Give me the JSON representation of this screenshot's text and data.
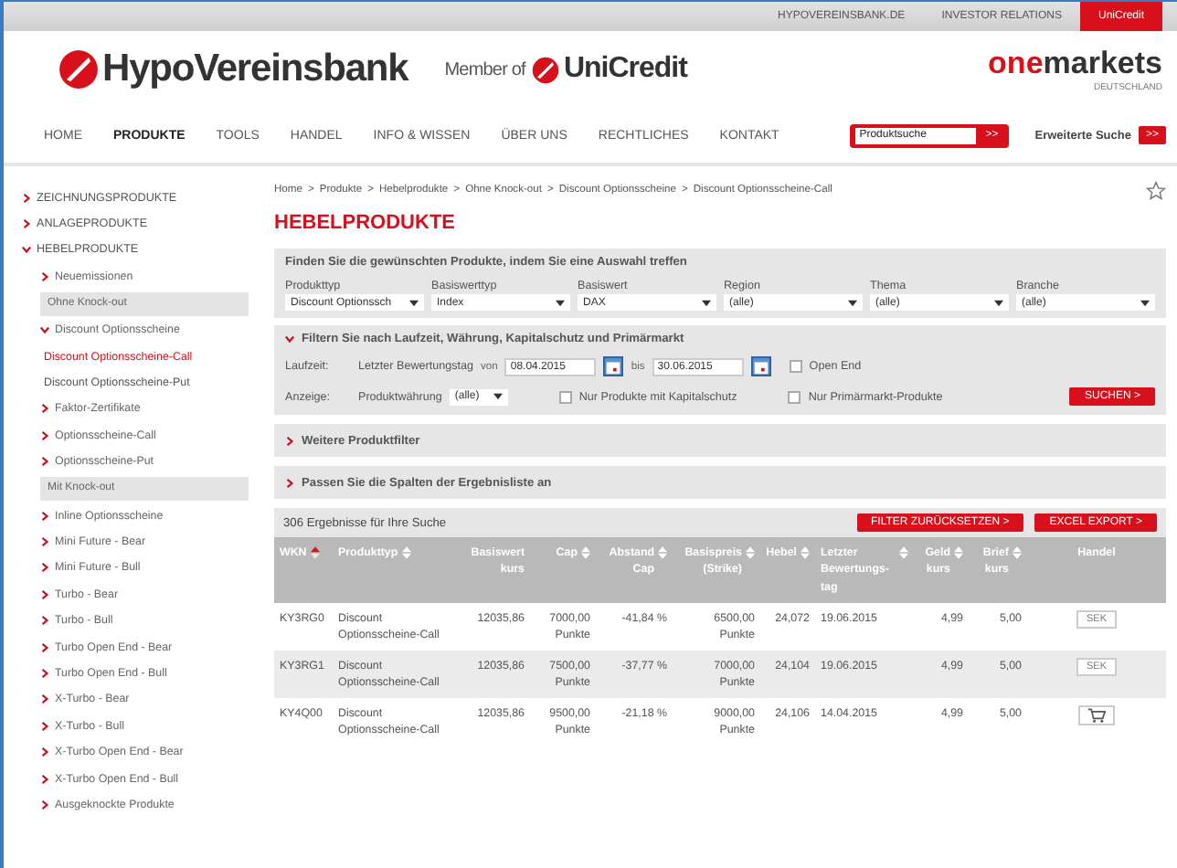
{
  "top_links": [
    {
      "label": "HYPOVEREINSBANK.DE",
      "selected": false
    },
    {
      "label": "INVESTOR RELATIONS",
      "selected": false
    },
    {
      "label": "UniCredit",
      "selected": true
    }
  ],
  "header": {
    "bank_name": "HypoVereinsbank",
    "member_of": "Member of",
    "group_name": "UniCredit",
    "brand_prefix": "one",
    "brand_suffix": "markets",
    "brand_country": "DEUTSCHLAND"
  },
  "nav": [
    {
      "label": "HOME",
      "selected": false
    },
    {
      "label": "PRODUKTE",
      "selected": true
    },
    {
      "label": "TOOLS",
      "selected": false
    },
    {
      "label": "HANDEL",
      "selected": false
    },
    {
      "label": "INFO & WISSEN",
      "selected": false
    },
    {
      "label": "ÜBER UNS",
      "selected": false
    },
    {
      "label": "RECHTLICHES",
      "selected": false
    },
    {
      "label": "KONTAKT",
      "selected": false
    }
  ],
  "search": {
    "value": "Produktsuche",
    "go": ">>",
    "advanced": "Erweiterte Suche",
    "advanced_go": ">>"
  },
  "sidebar": {
    "items": [
      {
        "label": "ZEICHNUNGSPRODUKTE",
        "kind": "category",
        "expanded": false
      },
      {
        "label": "ANLAGEPRODUKTE",
        "kind": "category",
        "expanded": false
      },
      {
        "label": "HEBELPRODUKTE",
        "kind": "category",
        "expanded": true,
        "children": [
          {
            "label": "Neuemissionen",
            "kind": "link",
            "expanded": false
          },
          {
            "label": "Ohne Knock-out",
            "kind": "group"
          },
          {
            "label": "Discount Optionsscheine",
            "kind": "link",
            "expanded": true,
            "children": [
              {
                "label": "Discount Optionsscheine-Call",
                "kind": "leaf",
                "selected": true
              },
              {
                "label": "Discount Optionsscheine-Put",
                "kind": "leaf",
                "selected": false
              }
            ]
          },
          {
            "label": "Faktor-Zertifikate",
            "kind": "link",
            "expanded": false
          },
          {
            "label": "Optionsscheine-Call",
            "kind": "link",
            "expanded": false
          },
          {
            "label": "Optionsscheine-Put",
            "kind": "link",
            "expanded": false
          },
          {
            "label": "Mit Knock-out",
            "kind": "group"
          },
          {
            "label": "Inline Optionsscheine",
            "kind": "link",
            "expanded": false
          },
          {
            "label": "Mini Future - Bear",
            "kind": "link",
            "expanded": false
          },
          {
            "label": "Mini Future - Bull",
            "kind": "link",
            "expanded": false
          },
          {
            "label": "Turbo - Bear",
            "kind": "link",
            "expanded": false
          },
          {
            "label": "Turbo - Bull",
            "kind": "link",
            "expanded": false
          },
          {
            "label": "Turbo Open End - Bear",
            "kind": "link",
            "expanded": false
          },
          {
            "label": "Turbo Open End - Bull",
            "kind": "link",
            "expanded": false
          },
          {
            "label": "X-Turbo - Bear",
            "kind": "link",
            "expanded": false
          },
          {
            "label": "X-Turbo - Bull",
            "kind": "link",
            "expanded": false
          },
          {
            "label": "X-Turbo Open End - Bear",
            "kind": "link",
            "expanded": false
          },
          {
            "label": "X-Turbo Open End - Bull",
            "kind": "link",
            "expanded": false
          },
          {
            "label": "Ausgeknockte Produkte",
            "kind": "link",
            "expanded": false
          }
        ]
      }
    ]
  },
  "breadcrumb": [
    "Home",
    "Produkte",
    "Hebelprodukte",
    "Ohne Knock-out",
    "Discount Optionsscheine",
    "Discount Optionsscheine-Call"
  ],
  "breadcrumb_separator": ">",
  "page_title": "HEBELPRODUKTE",
  "finder": {
    "heading": "Finden Sie die gewünschten Produkte, indem Sie eine Auswahl treffen",
    "selects": [
      {
        "label": "Produkttyp",
        "value": "Discount Optionssch"
      },
      {
        "label": "Basiswerttyp",
        "value": "Index"
      },
      {
        "label": "Basiswert",
        "value": "DAX"
      },
      {
        "label": "Region",
        "value": "(alle)"
      },
      {
        "label": "Thema",
        "value": "(alle)"
      },
      {
        "label": "Branche",
        "value": "(alle)"
      }
    ]
  },
  "filter": {
    "heading": "Filtern Sie nach Laufzeit, Währung, Kapitalschutz und Primärmarkt",
    "expanded": true,
    "term_label": "Laufzeit:",
    "term_field": "Letzter Bewertungstag",
    "from_label": "von",
    "from": "08.04.2015",
    "to_label": "bis",
    "to": "30.06.2015",
    "open_end": {
      "label": "Open End",
      "checked": false
    },
    "display_label": "Anzeige:",
    "currency_label": "Produktwährung",
    "currency": "(alle)",
    "capital_protection": {
      "label": "Nur Produkte mit Kapitalschutz",
      "checked": false
    },
    "primary_market": {
      "label": "Nur Primärmarkt-Produkte",
      "checked": false
    },
    "search_button": "SUCHEN >"
  },
  "sections": [
    {
      "heading": "Weitere Produktfilter",
      "expanded": false
    },
    {
      "heading": "Passen Sie die Spalten der Ergebnisliste an",
      "expanded": false
    }
  ],
  "results": {
    "count_text": "306 Ergebnisse für Ihre Suche",
    "reset_button": "FILTER ZURÜCKSETZEN >",
    "export_button": "EXCEL EXPORT >"
  },
  "table": {
    "columns": [
      {
        "label": "WKN",
        "sortable": true,
        "sorted": true
      },
      {
        "label": "Produkttyp",
        "sortable": true,
        "sorted": false
      },
      {
        "label": "Basiswert kurs",
        "sortable": false,
        "sorted": false
      },
      {
        "label": "Cap",
        "sortable": true,
        "sorted": false
      },
      {
        "label": "Abstand Cap",
        "sortable": true,
        "sorted": false
      },
      {
        "label": "Basispreis (Strike)",
        "sortable": true,
        "sorted": false
      },
      {
        "label": "Hebel",
        "sortable": true,
        "sorted": false
      },
      {
        "label": "Letzter Bewertungs-tag",
        "sortable": true,
        "sorted": false
      },
      {
        "label": "Geld kurs",
        "sortable": true,
        "sorted": false
      },
      {
        "label": "Brief kurs",
        "sortable": true,
        "sorted": false
      },
      {
        "label": "Handel",
        "sortable": false,
        "sorted": false
      }
    ],
    "rows": [
      {
        "cells": [
          "KY3RG0",
          "Discount Optionsscheine-Call",
          "12035,86",
          "7000,00 Punkte",
          "-41,84 %",
          "6500,00 Punkte",
          "24,072",
          "19.06.2015",
          "4,99",
          "5,00"
        ],
        "trade": {
          "kind": "button",
          "label": "SEK"
        }
      },
      {
        "cells": [
          "KY3RG1",
          "Discount Optionsscheine-Call",
          "12035,86",
          "7500,00 Punkte",
          "-37,77 %",
          "7000,00 Punkte",
          "24,104",
          "19.06.2015",
          "4,99",
          "5,00"
        ],
        "trade": {
          "kind": "button",
          "label": "SEK"
        }
      },
      {
        "cells": [
          "KY4Q00",
          "Discount Optionsscheine-Call",
          "12035,86",
          "9500,00 Punkte",
          "-21,18 %",
          "9000,00 Punkte",
          "24,106",
          "14.04.2015",
          "4,99",
          "5,00"
        ],
        "trade": {
          "kind": "cart"
        }
      }
    ]
  }
}
